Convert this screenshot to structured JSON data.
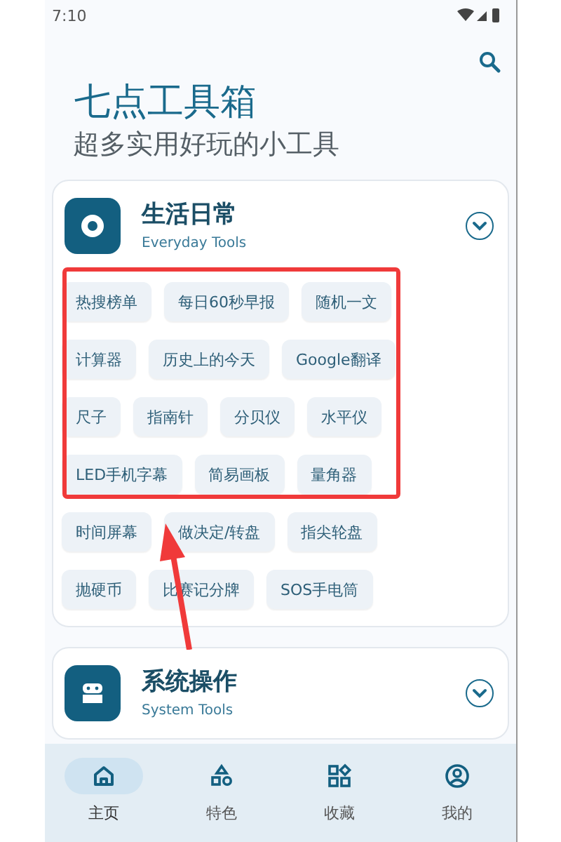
{
  "status_bar": {
    "time": "7:10"
  },
  "header": {
    "title": "七点工具箱",
    "subtitle": "超多实用好玩的小工具"
  },
  "categories": [
    {
      "title": "生活日常",
      "subtitle": "Everyday Tools",
      "tool_rows": [
        [
          "热搜榜单",
          "每日60秒早报",
          "随机一文"
        ],
        [
          "计算器",
          "历史上的今天",
          "Google翻译"
        ],
        [
          "尺子",
          "指南针",
          "分贝仪",
          "水平仪"
        ],
        [
          "LED手机字幕",
          "简易画板",
          "量角器"
        ],
        [
          "时间屏幕",
          "做决定/转盘",
          "指尖轮盘"
        ],
        [
          "抛硬币",
          "比赛记分牌",
          "SOS手电筒"
        ]
      ]
    },
    {
      "title": "系统操作",
      "subtitle": "System Tools"
    }
  ],
  "nav": [
    {
      "label": "主页",
      "selected": true
    },
    {
      "label": "特色",
      "selected": false
    },
    {
      "label": "收藏",
      "selected": false
    },
    {
      "label": "我的",
      "selected": false
    }
  ]
}
